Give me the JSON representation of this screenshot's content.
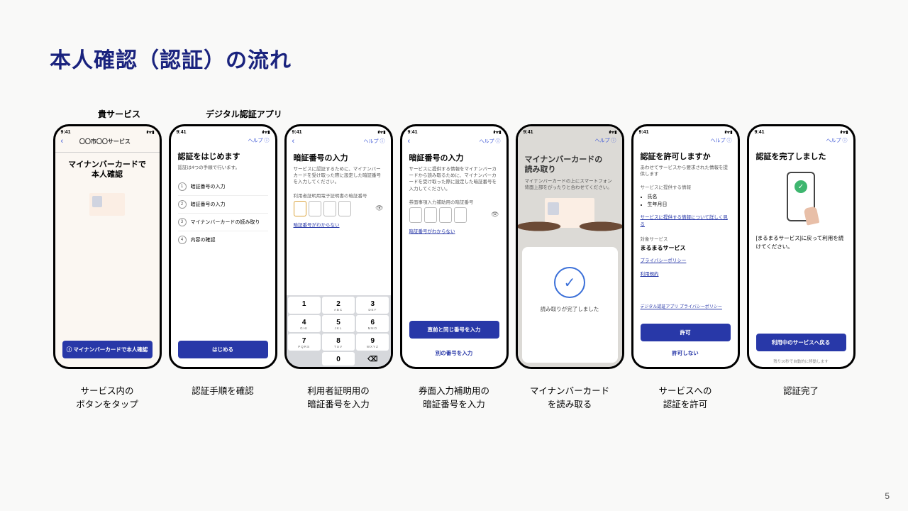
{
  "title": "本人確認（認証）の流れ",
  "pageNumber": "5",
  "topLabels": {
    "service": "貴サービス",
    "app": "デジタル認証アプリ"
  },
  "statusBar": {
    "time": "9:41",
    "signals": "ııl ᯤ ▮"
  },
  "help": "ヘルプ ⓘ",
  "screens": {
    "s1": {
      "header": "〇〇市〇〇サービス",
      "heading": "マイナンバーカードで\n本人確認",
      "button": "ⓘ マイナンバーカードで本人確認"
    },
    "s2": {
      "heading": "認証をはじめます",
      "sub": "認証は4つの手順で行います。",
      "steps": [
        "暗証番号の入力",
        "暗証番号の入力",
        "マイナンバーカードの読み取り",
        "内容の確認"
      ],
      "button": "はじめる"
    },
    "s3": {
      "heading": "暗証番号の入力",
      "sub": "サービスに認証するために、マイナンバーカードを受け取った際に設定した暗証番号を入力してください。",
      "pinLabel": "利用者証明用電子証明書の暗証番号",
      "link": "暗証番号がわからない",
      "keypad": [
        [
          "1",
          ""
        ],
        [
          "2",
          "ABС"
        ],
        [
          "3",
          "DEF"
        ],
        [
          "4",
          "GHI"
        ],
        [
          "5",
          "JKL"
        ],
        [
          "6",
          "MNO"
        ],
        [
          "7",
          "PQRS"
        ],
        [
          "8",
          "TUV"
        ],
        [
          "9",
          "WXYZ"
        ],
        [
          "",
          ""
        ],
        [
          "0",
          ""
        ],
        [
          "⌫",
          ""
        ]
      ]
    },
    "s4": {
      "heading": "暗証番号の入力",
      "sub": "サービスに提供する情報をマイナンバーカードから読み取るために、マイナンバーカードを受け取った際に設定した暗証番号を入力してください。",
      "pinLabel": "券面事項入力補助用の暗証番号",
      "link": "暗証番号がわからない",
      "button": "直前と同じ番号を入力",
      "secondary": "別の番号を入力"
    },
    "s5": {
      "heading": "マイナンバーカードの\n読み取り",
      "sub": "マイナンバーカードの上にスマートフォン背面上部をぴったりと合わせてください。",
      "done": "読み取りが完了しました"
    },
    "s6": {
      "heading": "認証を許可しますか",
      "sub": "あわせてサービスから要求された情報を提供します",
      "secLabel": "サービスに提供する情報",
      "items": [
        "氏名",
        "生年月日"
      ],
      "detailLink": "サービスに提供する情報について詳しく見る",
      "targetLabel": "対象サービス",
      "serviceName": "まるまるサービス",
      "pp": "プライバシーポリシー",
      "tos": "利用規約",
      "footerLink": "デジタル認証アプリ プライバシーポリシー",
      "allow": "許可",
      "deny": "許可しない"
    },
    "s7": {
      "heading": "認証を完了しました",
      "msg": "[まるまるサービス]に戻って利用を続けてください。",
      "button": "利用中のサービスへ戻る",
      "note": "残り10秒で自動的に移動します"
    }
  },
  "captions": [
    "サービス内の\nボタンをタップ",
    "認証手順を確認",
    "利用者証明用の\n暗証番号を入力",
    "券面入力補助用の\n暗証番号を入力",
    "マイナンバーカード\nを読み取る",
    "サービスへの\n認証を許可",
    "認証完了"
  ]
}
